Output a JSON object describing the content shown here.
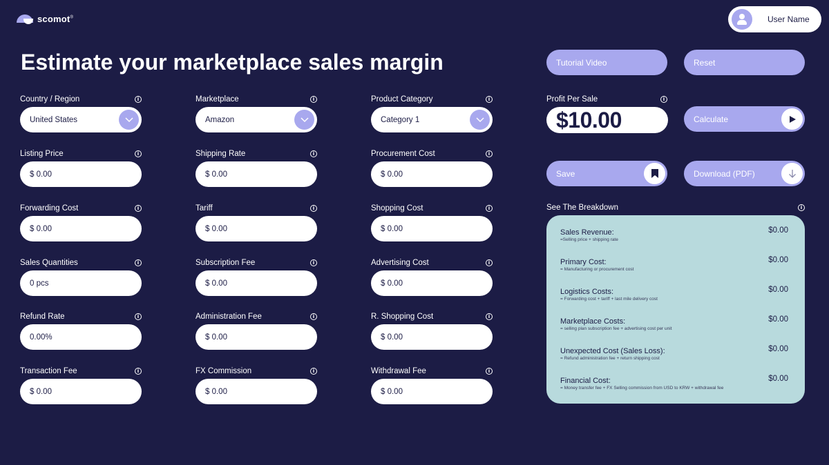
{
  "brand": {
    "name": "scomot",
    "mark": "®"
  },
  "user": {
    "name": "User Name",
    "avatar_icon": "user-avatar-icon"
  },
  "title": "Estimate your marketplace sales margin",
  "actions": {
    "tutorial": "Tutorial Video",
    "reset": "Reset",
    "calculate": "Calculate",
    "save": "Save",
    "download": "Download (PDF)"
  },
  "columns": [
    [
      {
        "label": "Country / Region",
        "value": "United States",
        "type": "select"
      },
      {
        "label": "Listing Price",
        "value": "$ 0.00"
      },
      {
        "label": "Forwarding Cost",
        "value": "$ 0.00"
      },
      {
        "label": "Sales Quantities",
        "value": "0 pcs"
      },
      {
        "label": "Refund Rate",
        "value": "0.00%"
      },
      {
        "label": "Transaction Fee",
        "value": "$ 0.00"
      }
    ],
    [
      {
        "label": "Marketplace",
        "value": "Amazon",
        "type": "select"
      },
      {
        "label": "Shipping Rate",
        "value": "$ 0.00"
      },
      {
        "label": "Tariff",
        "value": "$ 0.00"
      },
      {
        "label": "Subscription Fee",
        "value": "$ 0.00"
      },
      {
        "label": "Administration Fee",
        "value": "$ 0.00"
      },
      {
        "label": "FX Commission",
        "value": "$ 0.00"
      }
    ],
    [
      {
        "label": "Product Category",
        "value": "Category 1",
        "type": "select"
      },
      {
        "label": "Procurement Cost",
        "value": "$ 0.00"
      },
      {
        "label": "Shopping Cost",
        "value": "$ 0.00"
      },
      {
        "label": "Advertising Cost",
        "value": "$ 0.00"
      },
      {
        "label": "R. Shopping Cost",
        "value": "$ 0.00"
      },
      {
        "label": "Withdrawal Fee",
        "value": "$ 0.00"
      }
    ]
  ],
  "profit": {
    "label": "Profit Per Sale",
    "value": "$10.00"
  },
  "breakdown": {
    "label": "See The Breakdown",
    "items": [
      {
        "title": "Sales Revenue:",
        "sub": "=Selling price + shipping rate",
        "value": "$0.00"
      },
      {
        "title": "Primary Cost:",
        "sub": "= Manufacturing or procurement cost",
        "value": "$0.00"
      },
      {
        "title": "Logistics Costs:",
        "sub": "= Forwarding cost + tariff + last mile delivery cost",
        "value": "$0.00"
      },
      {
        "title": "Marketplace Costs:",
        "sub": "= selling plan subscription fee + advertising cost per unit",
        "value": "$0.00"
      },
      {
        "title": "Unexpected Cost (Sales Loss):",
        "sub": "= Refund administration fee + return shipping cost",
        "value": "$0.00"
      },
      {
        "title": "Financial Cost:",
        "sub": "= Money transfer fee + FX Selling commission from USD to KRW + withdrawal fee",
        "value": "$0.00"
      }
    ]
  },
  "colors": {
    "background": "#1c1c45",
    "accent": "#a8a8ee",
    "panel": "#b8dadd",
    "input": "#ffffff"
  }
}
